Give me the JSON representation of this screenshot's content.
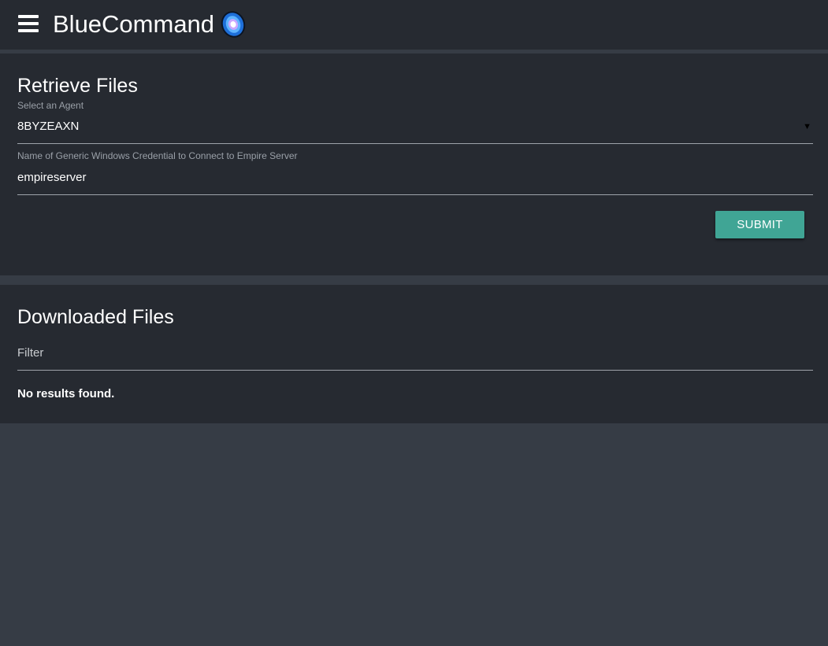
{
  "header": {
    "app_title": "BlueCommand",
    "menu_icon": "hamburger-menu-icon",
    "logo_icon": "bluecommand-logo-icon"
  },
  "retrieve_files": {
    "title": "Retrieve Files",
    "agent_select": {
      "label": "Select an Agent",
      "selected_value": "8BYZEAXN",
      "icon": "dropdown-arrow-icon"
    },
    "credential_field": {
      "label": "Name of Generic Windows Credential to Connect to Empire Server",
      "value": "empireserver"
    },
    "submit_label": "SUBMIT"
  },
  "downloaded_files": {
    "title": "Downloaded Files",
    "filter_placeholder": "Filter",
    "empty_message": "No results found."
  },
  "colors": {
    "page_background": "#363c45",
    "card_background": "#262a31",
    "accent": "#40a595",
    "logo_blue": "#1e6fd9"
  }
}
